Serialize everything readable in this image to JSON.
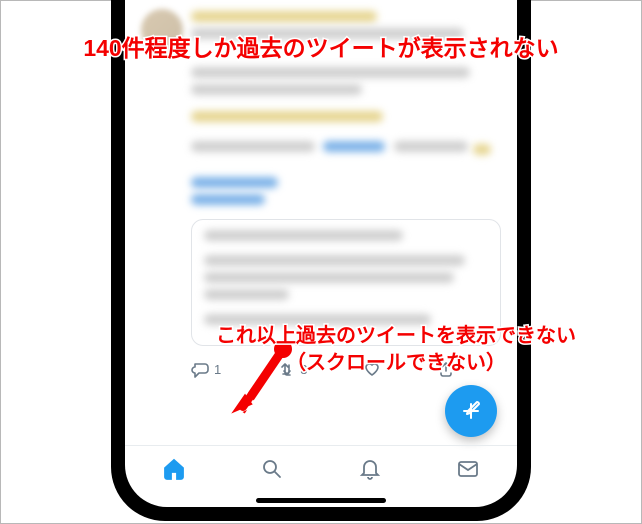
{
  "annotations": {
    "top": "140件程度しか過去のツイートが表示されない",
    "bottom_line1": "これ以上過去のツイートを表示できない",
    "bottom_line2": "（スクロールできない）"
  },
  "actions": {
    "reply_count": "1",
    "retweet_count": "3"
  },
  "icons": {
    "reply": "reply-icon",
    "retweet": "retweet-icon",
    "like": "like-icon",
    "share": "share-icon",
    "compose": "compose-icon",
    "home": "home-icon",
    "search": "search-icon",
    "notifications": "bell-icon",
    "messages": "envelope-icon"
  },
  "colors": {
    "accent": "#1d9bf0",
    "annotation": "#f40000"
  }
}
